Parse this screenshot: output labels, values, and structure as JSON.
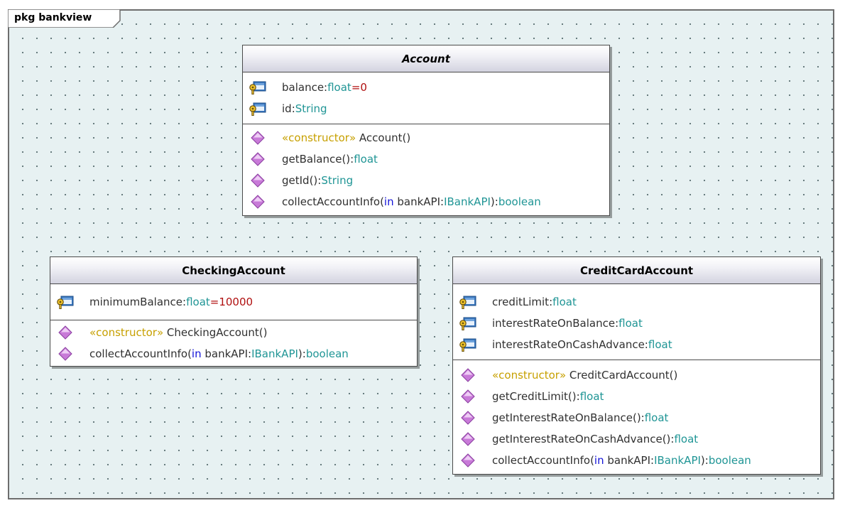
{
  "package": {
    "label": "pkg bankview"
  },
  "colors": {
    "canvas": "#e7f1f2",
    "type": "#1f9595",
    "default_value": "#b01010",
    "stereotype": "#c7a000",
    "keyword": "#1414d8",
    "operation_icon": "#c87ad8"
  },
  "classes": {
    "account": {
      "name": "Account",
      "abstract": true,
      "attributes": [
        {
          "name": "balance:",
          "type": "float",
          "default": "=0"
        },
        {
          "name": "id:",
          "type": "String"
        }
      ],
      "operations": [
        {
          "stereotype": "«constructor»",
          "name": " Account()"
        },
        {
          "name": "getBalance():",
          "type": "float"
        },
        {
          "name": "getId():",
          "type": "String"
        },
        {
          "name": "collectAccountInfo(",
          "kw": "in",
          "param": " bankAPI:",
          "ptype": "IBankAPI",
          "close": "):",
          "type": "boolean"
        }
      ]
    },
    "checking": {
      "name": "CheckingAccount",
      "attributes": [
        {
          "name": "minimumBalance:",
          "type": "float",
          "default": "=10000"
        }
      ],
      "operations": [
        {
          "stereotype": "«constructor»",
          "name": " CheckingAccount()"
        },
        {
          "name": "collectAccountInfo(",
          "kw": "in",
          "param": " bankAPI:",
          "ptype": "IBankAPI",
          "close": "):",
          "type": "boolean"
        }
      ]
    },
    "credit": {
      "name": "CreditCardAccount",
      "attributes": [
        {
          "name": "creditLimit:",
          "type": "float"
        },
        {
          "name": "interestRateOnBalance:",
          "type": "float"
        },
        {
          "name": "interestRateOnCashAdvance:",
          "type": "float"
        }
      ],
      "operations": [
        {
          "stereotype": "«constructor»",
          "name": " CreditCardAccount()"
        },
        {
          "name": "getCreditLimit():",
          "type": "float"
        },
        {
          "name": "getInterestRateOnBalance():",
          "type": "float"
        },
        {
          "name": "getInterestRateOnCashAdvance():",
          "type": "float"
        },
        {
          "name": "collectAccountInfo(",
          "kw": "in",
          "param": " bankAPI:",
          "ptype": "IBankAPI",
          "close": "):",
          "type": "boolean"
        }
      ]
    }
  }
}
